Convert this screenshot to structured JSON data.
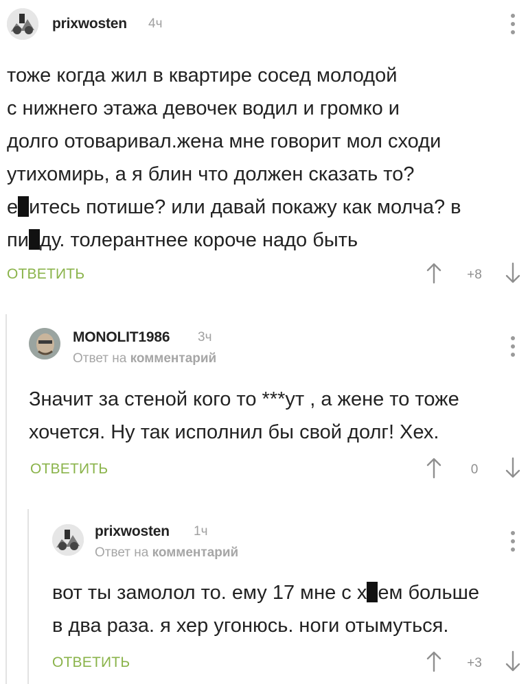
{
  "comments": [
    {
      "user": "prixwosten",
      "time": "4ч",
      "lines": [
        "тоже когда жил в квартире сосед молодой",
        "с нижнего этажа девочек водил и громко и",
        "долго отоваривал.жена мне говорит мол сходи",
        "утихомирь, а я блин что должен сказать то?"
      ],
      "line5_a": "е",
      "line5_b": "итесь потише? или давай покажу как молча? в",
      "line6_a": "пи",
      "line6_b": "ду. толерантнее короче надо быть",
      "reply_label": "ОТВЕТИТЬ",
      "score": "+8"
    },
    {
      "user": "MONOLIT1986",
      "time": "3ч",
      "reply_prefix": "Ответ на",
      "reply_target": "комментарий",
      "lines": [
        "Значит за стеной кого то ***ут , а жене то тоже",
        "хочется. Ну так исполнил бы свой долг! Хех."
      ],
      "reply_label": "ОТВЕТИТЬ",
      "score": "0"
    },
    {
      "user": "prixwosten",
      "time": "1ч",
      "reply_prefix": "Ответ на",
      "reply_target": "комментарий",
      "line1_a": "вот ты замолол то. ему 17 мне с х",
      "line1_b": "ем больше",
      "line2": "в два раза. я хер угонюсь. ноги отымуться.",
      "reply_label": "ОТВЕТИТЬ",
      "score": "+3"
    }
  ],
  "colors": {
    "accent_green": "#8ab34a",
    "text": "#222222",
    "muted": "#a0a0a0",
    "thread_line": "#e2e2e2"
  },
  "icons": [
    "avatar",
    "kebab-menu-icon",
    "arrow-up-icon",
    "arrow-down-icon"
  ]
}
